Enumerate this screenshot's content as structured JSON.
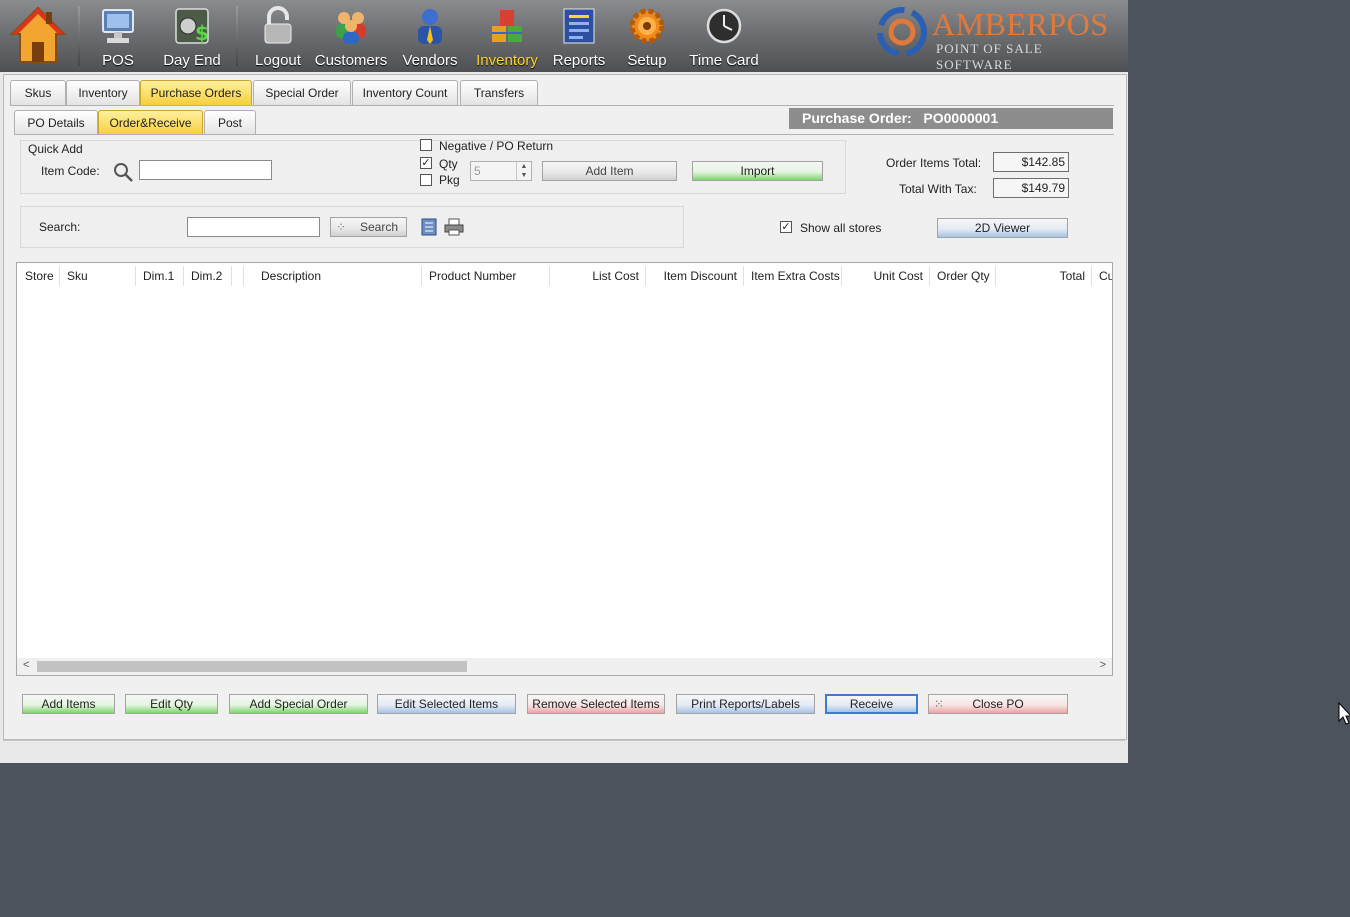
{
  "toolbar": {
    "items": [
      {
        "label": "POS",
        "icon": "pos-terminal-icon"
      },
      {
        "label": "Day End",
        "icon": "safe-icon"
      },
      {
        "label": "Logout",
        "icon": "padlock-icon"
      },
      {
        "label": "Customers",
        "icon": "customers-icon"
      },
      {
        "label": "Vendors",
        "icon": "vendor-icon"
      },
      {
        "label": "Inventory",
        "icon": "boxes-icon"
      },
      {
        "label": "Reports",
        "icon": "report-icon"
      },
      {
        "label": "Setup",
        "icon": "gear-icon"
      },
      {
        "label": "Time Card",
        "icon": "clock-icon"
      }
    ],
    "active": "Inventory"
  },
  "logo": {
    "brand": "AMBERPOS",
    "sub": "POINT OF SALE SOFTWARE"
  },
  "tabs_main": [
    "Skus",
    "Inventory",
    "Purchase Orders",
    "Special Order",
    "Inventory Count",
    "Transfers"
  ],
  "tabs_sub": [
    "PO Details",
    "Order&Receive",
    "Post"
  ],
  "po": {
    "label": "Purchase Order:",
    "number": "PO0000001"
  },
  "quick_add": {
    "title": "Quick Add",
    "item_code_label": "Item Code:",
    "item_code_value": "",
    "negative_label": "Negative / PO Return",
    "qty_label": "Qty",
    "pkg_label": "Pkg",
    "qty_value": "5",
    "add_item": "Add Item",
    "import": "Import"
  },
  "totals": {
    "order_items_label": "Order Items Total:",
    "order_items_value": "$142.85",
    "with_tax_label": "Total With Tax:",
    "with_tax_value": "$149.79"
  },
  "search": {
    "label": "Search:",
    "value": "",
    "button": "Search",
    "show_all_stores": "Show all stores",
    "viewer": "2D Viewer"
  },
  "grid": {
    "columns": [
      "Store",
      "Sku",
      "Dim.1",
      "Dim.2",
      "",
      "Description",
      "Product Number",
      "List Cost",
      "Item Discount",
      "Item Extra Costs",
      "Unit Cost",
      "Order Qty",
      "Total",
      "Cu"
    ]
  },
  "actions": {
    "add_items": "Add Items",
    "edit_qty": "Edit Qty",
    "add_special_order": "Add Special Order",
    "edit_selected": "Edit Selected Items",
    "remove_selected": "Remove Selected Items",
    "print_reports": "Print Reports/Labels",
    "receive": "Receive",
    "close_po": "Close PO"
  }
}
